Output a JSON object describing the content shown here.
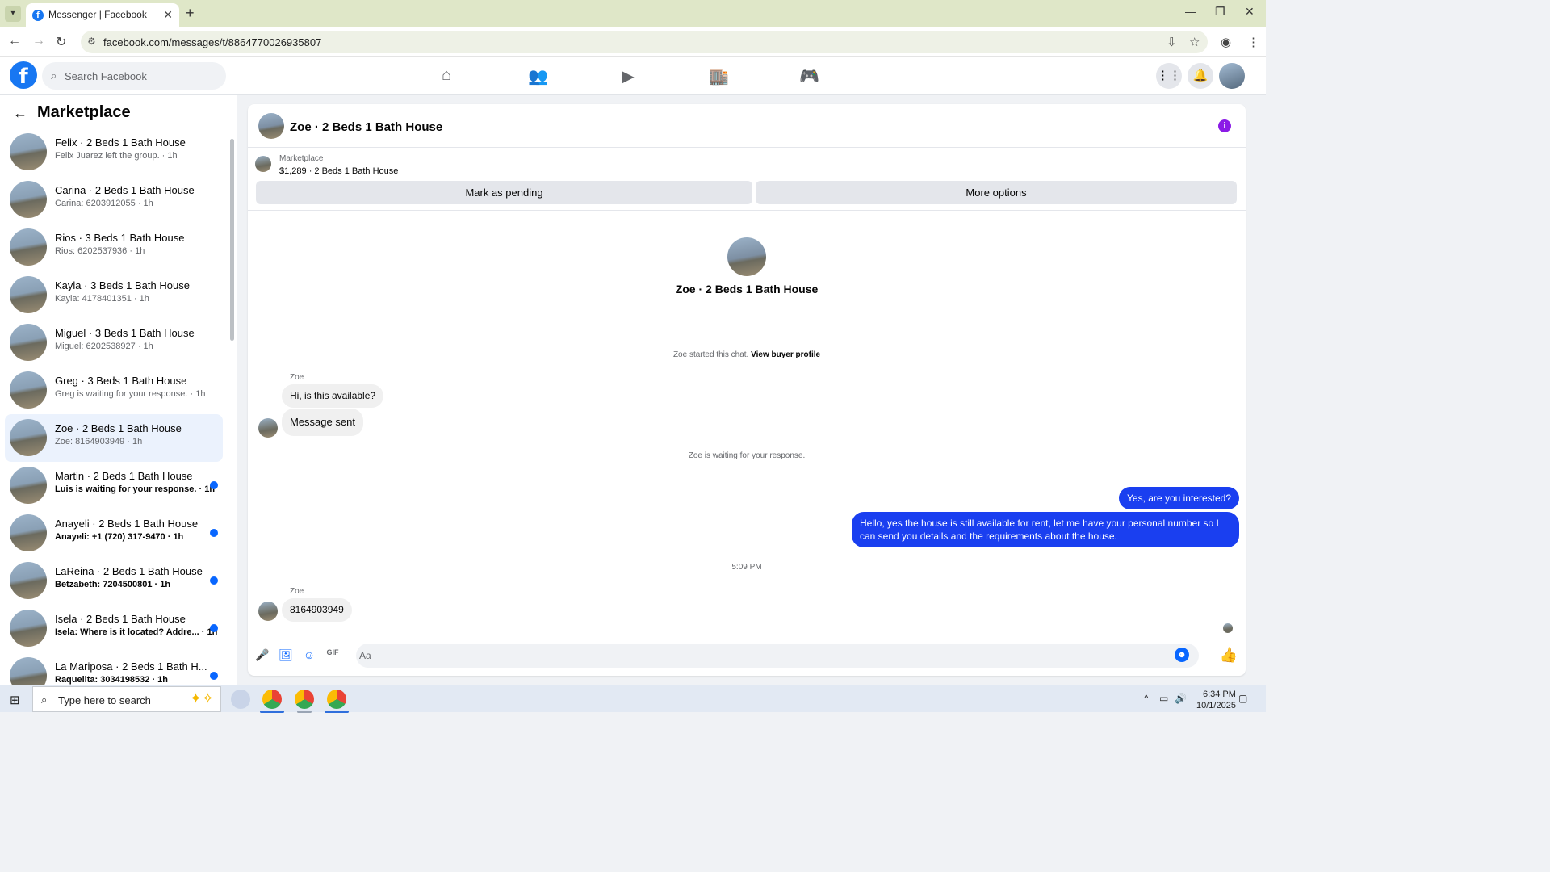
{
  "browser": {
    "tab_title": "Messenger | Facebook",
    "url": "facebook.com/messages/t/8864770026935807"
  },
  "fb": {
    "search_placeholder": "Search Facebook"
  },
  "sidebar": {
    "title": "Marketplace",
    "conversations": [
      {
        "name": "Felix · 2 Beds 1 Bath House",
        "preview": "Felix Juarez left the group. · 1h",
        "unread": false,
        "active": false
      },
      {
        "name": "Carina · 2 Beds 1 Bath House",
        "preview": "Carina: 6203912055 · 1h",
        "unread": false,
        "active": false
      },
      {
        "name": "Rios · 3 Beds 1 Bath House",
        "preview": "Rios: 6202537936 · 1h",
        "unread": false,
        "active": false
      },
      {
        "name": "Kayla · 3 Beds 1 Bath House",
        "preview": "Kayla: 4178401351 · 1h",
        "unread": false,
        "active": false
      },
      {
        "name": "Miguel · 3 Beds 1 Bath House",
        "preview": "Miguel: 6202538927 · 1h",
        "unread": false,
        "active": false
      },
      {
        "name": "Greg · 3 Beds 1 Bath House",
        "preview": "Greg is waiting for your response. · 1h",
        "unread": false,
        "active": false
      },
      {
        "name": "Zoe · 2 Beds 1 Bath House",
        "preview": "Zoe: 8164903949 · 1h",
        "unread": false,
        "active": true
      },
      {
        "name": "Martin · 2 Beds 1 Bath House",
        "preview": "Luis is waiting for your response. · 1h",
        "unread": true,
        "active": false
      },
      {
        "name": "Anayeli · 2 Beds 1 Bath House",
        "preview": "Anayeli: +1 (720) 317-9470 · 1h",
        "unread": true,
        "active": false
      },
      {
        "name": "LaReina · 2 Beds 1 Bath House",
        "preview": "Betzabeth: 7204500801 · 1h",
        "unread": true,
        "active": false
      },
      {
        "name": "Isela · 2 Beds 1 Bath House",
        "preview": "Isela: Where is it located? Addre... · 1h",
        "unread": true,
        "active": false
      },
      {
        "name": "La Mariposa · 2 Beds 1 Bath H...",
        "preview": "Raquelita: 3034198532 · 1h",
        "unread": true,
        "active": false
      }
    ]
  },
  "chat": {
    "title": "Zoe · 2 Beds 1 Bath House",
    "marketplace_label": "Marketplace",
    "listing": "$1,289 · 2 Beds 1 Bath House",
    "mark_pending": "Mark as pending",
    "more_options": "More options",
    "hero_name": "Zoe · 2 Beds 1 Bath House",
    "started_text": "Zoe started this chat.",
    "view_profile": "View buyer profile",
    "sender": "Zoe",
    "msg1": "Hi, is this available?",
    "msg2": "Message sent",
    "waiting": "Zoe is waiting for your response.",
    "out1": "Yes, are you interested?",
    "out2": "Hello, yes the house is still available for rent, let me have your personal number so I can send you details and the requirements about the house.",
    "time": "5:09 PM",
    "msg3": "8164903949",
    "composer_placeholder": "Aa"
  },
  "taskbar": {
    "search_placeholder": "Type here to search",
    "time": "6:34 PM",
    "date": "10/1/2025"
  }
}
